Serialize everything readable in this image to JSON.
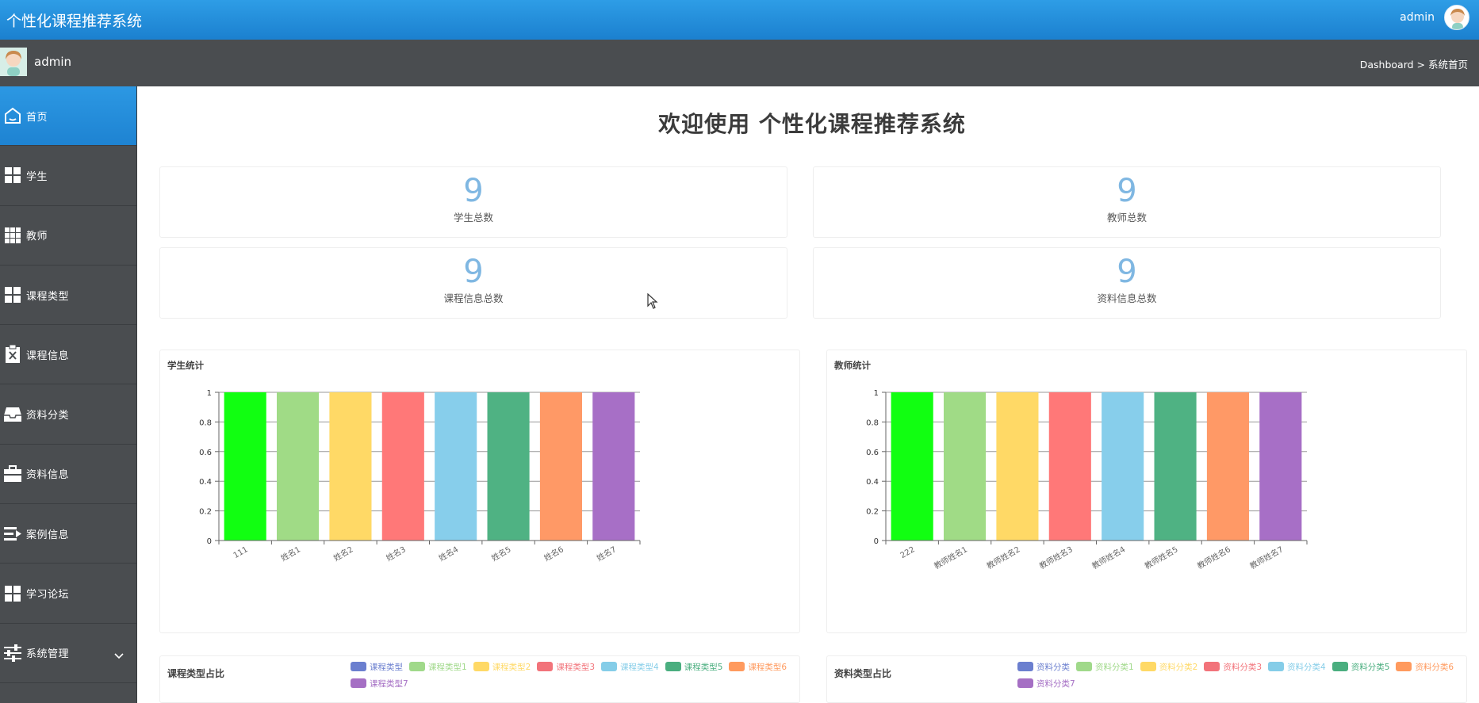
{
  "header": {
    "app_title": "个性化课程推荐系统",
    "username": "admin"
  },
  "subheader": {
    "username": "admin",
    "breadcrumb": "Dashboard > 系统首页"
  },
  "sidebar": {
    "items": [
      {
        "label": "首页",
        "icon": "home-icon",
        "active": true
      },
      {
        "label": "学生",
        "icon": "grid-icon"
      },
      {
        "label": "教师",
        "icon": "grid-nine-icon"
      },
      {
        "label": "课程类型",
        "icon": "grid-icon"
      },
      {
        "label": "课程信息",
        "icon": "clipboard-x-icon"
      },
      {
        "label": "资料分类",
        "icon": "tray-icon"
      },
      {
        "label": "资料信息",
        "icon": "briefcase-icon"
      },
      {
        "label": "案例信息",
        "icon": "list-arrow-icon"
      },
      {
        "label": "学习论坛",
        "icon": "grid-icon"
      },
      {
        "label": "系统管理",
        "icon": "sliders-icon",
        "expandable": true
      }
    ]
  },
  "main": {
    "welcome": "欢迎使用 个性化课程推荐系统",
    "stats": [
      {
        "value": "9",
        "label": "学生总数"
      },
      {
        "value": "9",
        "label": "教师总数"
      },
      {
        "value": "9",
        "label": "课程信息总数"
      },
      {
        "value": "9",
        "label": "资料信息总数"
      }
    ],
    "pies": [
      {
        "title": "课程类型占比",
        "legend": [
          "课程类型",
          "课程类型1",
          "课程类型2",
          "课程类型3",
          "课程类型4",
          "课程类型5",
          "课程类型6",
          "课程类型7"
        ]
      },
      {
        "title": "资料类型占比",
        "legend": [
          "资料分类",
          "资料分类1",
          "资料分类2",
          "资料分类3",
          "资料分类4",
          "资料分类5",
          "资料分类6",
          "资料分类7"
        ]
      }
    ],
    "legend_colors": [
      "#6b7fcf",
      "#a0d98a",
      "#ffd966",
      "#f2737a",
      "#85cde8",
      "#4aae7f",
      "#ff9a5e",
      "#a56fc4"
    ]
  },
  "chart_data": [
    {
      "type": "bar",
      "title": "学生统计",
      "categories": [
        "111",
        "姓名1",
        "姓名2",
        "姓名3",
        "姓名4",
        "姓名5",
        "姓名6",
        "姓名7"
      ],
      "values": [
        1,
        1,
        1,
        1,
        1,
        1,
        1,
        1
      ],
      "ylim": [
        0,
        1
      ],
      "yticks": [
        "0",
        "0.2",
        "0.4",
        "0.6",
        "0.8",
        "1"
      ],
      "grid": true,
      "colors": [
        "#11ff11",
        "#a0db86",
        "#ffd966",
        "#ff7878",
        "#87ceeb",
        "#4fb283",
        "#ff9966",
        "#a76fc6"
      ]
    },
    {
      "type": "bar",
      "title": "教师统计",
      "categories": [
        "222",
        "教师姓名1",
        "教师姓名2",
        "教师姓名3",
        "教师姓名4",
        "教师姓名5",
        "教师姓名6",
        "教师姓名7"
      ],
      "values": [
        1,
        1,
        1,
        1,
        1,
        1,
        1,
        1
      ],
      "ylim": [
        0,
        1
      ],
      "yticks": [
        "0",
        "0.2",
        "0.4",
        "0.6",
        "0.8",
        "1"
      ],
      "grid": true,
      "colors": [
        "#11ff11",
        "#a0db86",
        "#ffd966",
        "#ff7878",
        "#87ceeb",
        "#4fb283",
        "#ff9966",
        "#a76fc6"
      ]
    }
  ]
}
